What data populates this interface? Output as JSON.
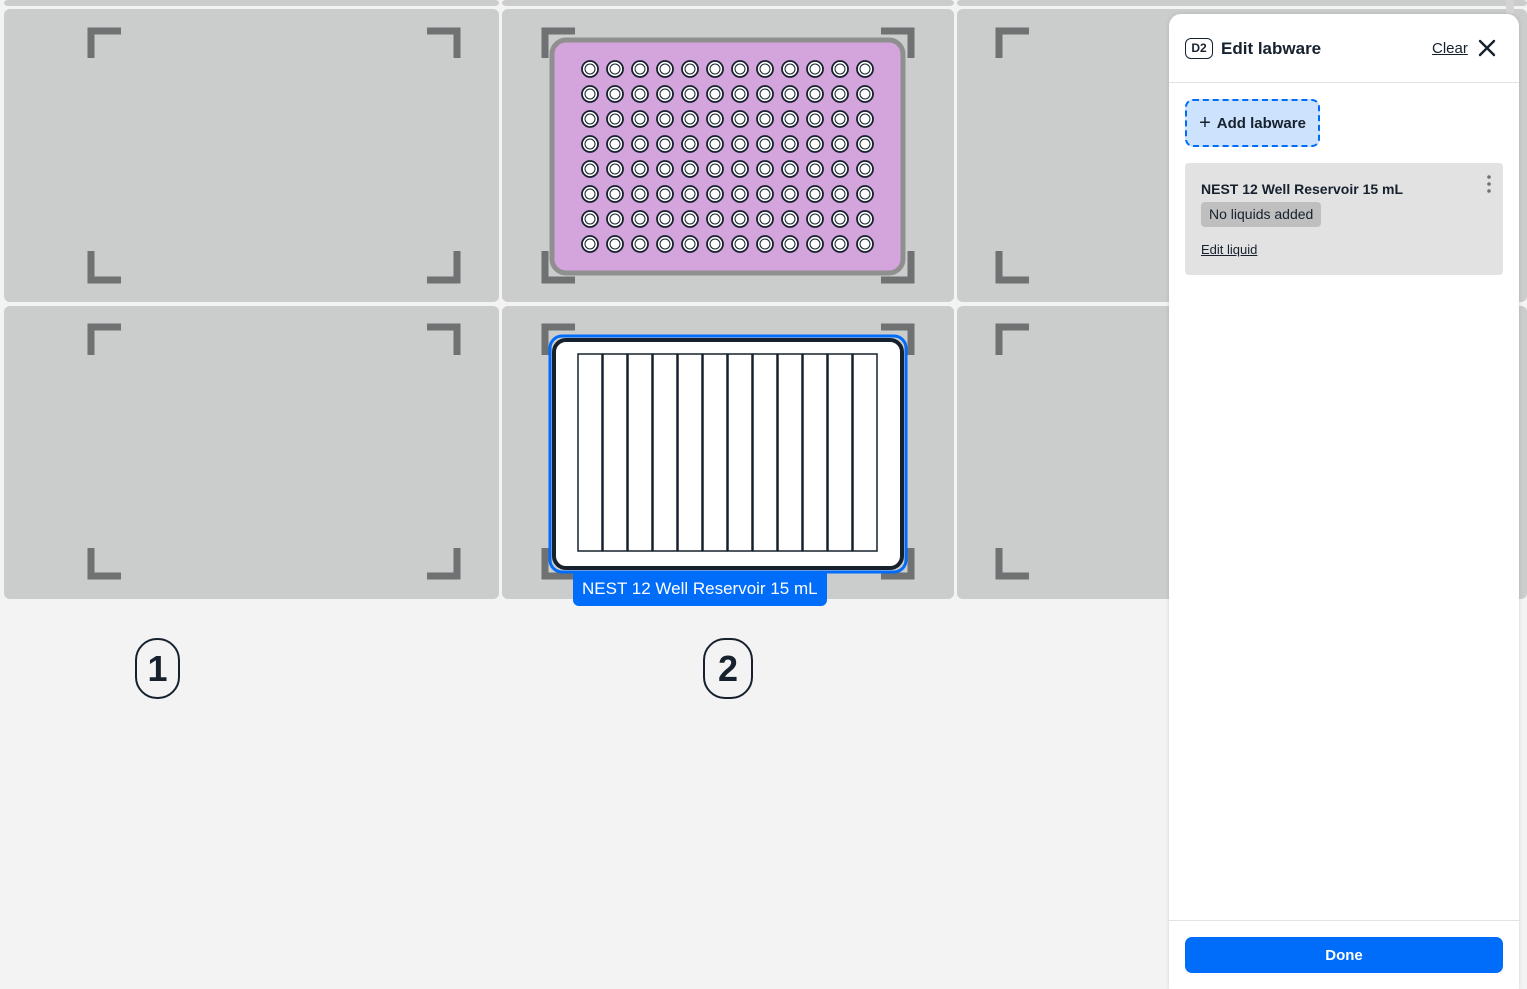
{
  "deck": {
    "slot_numbers": [
      "1",
      "2"
    ],
    "selected_labware_label": "NEST 12 Well Reservoir 15 mL",
    "colors": {
      "slot": "#cbcccc",
      "plate_fill": "#d4a5dd",
      "plate_border": "#8f8f8f",
      "selection": "#006cfa"
    }
  },
  "panel": {
    "slot_badge": "D2",
    "title": "Edit labware",
    "clear_label": "Clear",
    "close_icon": "close-icon",
    "add_labware_label": "Add labware",
    "labware_card": {
      "name": "NEST 12 Well Reservoir 15 mL",
      "liquid_status": "No liquids added",
      "edit_liquid_label": "Edit liquid",
      "menu_icon": "kebab-menu-icon"
    },
    "done_label": "Done"
  }
}
